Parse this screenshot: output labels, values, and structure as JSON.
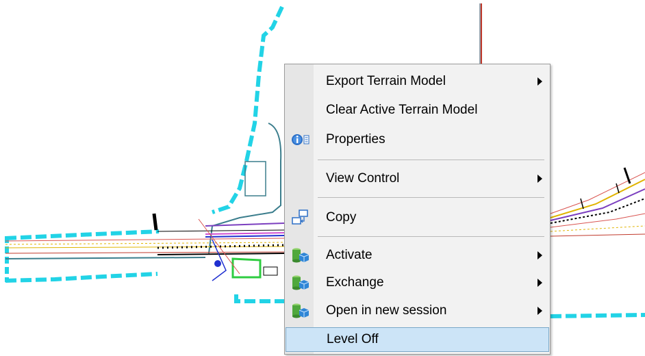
{
  "menu": {
    "items": [
      {
        "label": "Export Terrain Model",
        "submenu": true
      },
      {
        "label": "Clear Active Terrain Model",
        "submenu": false
      },
      {
        "label": "Properties",
        "submenu": false,
        "icon": "info-icon"
      },
      {
        "label": "View Control",
        "submenu": true
      },
      {
        "label": "Copy",
        "submenu": false,
        "icon": "copy-icon"
      },
      {
        "label": "Activate",
        "submenu": true,
        "icon": "terrain-cube-icon"
      },
      {
        "label": "Exchange",
        "submenu": true,
        "icon": "terrain-cube-icon"
      },
      {
        "label": "Open in new session",
        "submenu": true,
        "icon": "terrain-cube-icon"
      },
      {
        "label": "Level Off",
        "submenu": false,
        "highlighted": true
      }
    ]
  },
  "colors": {
    "terrain_boundary": "#22d3e6",
    "highlight": "#cce4f7",
    "menu_bg": "#f2f2f2"
  }
}
